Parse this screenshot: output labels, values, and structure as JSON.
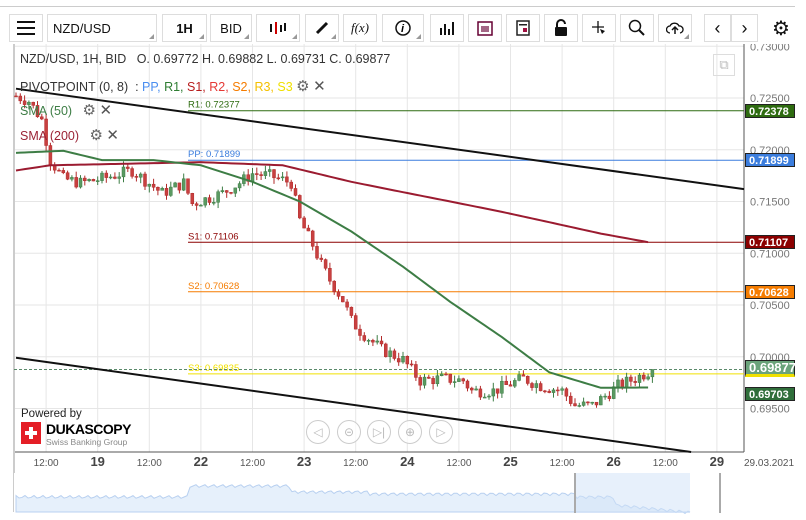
{
  "toolbar": {
    "instrument": "NZD/USD",
    "period": "1H",
    "side": "BID",
    "icons": [
      "menu-icon",
      "candlestick-icon",
      "pencil-icon",
      "function-icon",
      "info-icon",
      "volume-bars-icon",
      "calendar-icon",
      "news-icon",
      "lock-icon",
      "crosshair-icon",
      "zoom-search-icon",
      "cloud-upload-icon",
      "chevron-left-icon",
      "chevron-right-icon",
      "gear-icon"
    ],
    "fx_label": "f(x)"
  },
  "legend": {
    "title": "NZD/USD, 1H, BID",
    "ohlc": "O. 0.69772 H. 0.69882 L. 0.69731 C. 0.69877",
    "pivot": "PIVOTPOINT (0, 8)",
    "pivot_sep": ":",
    "pivot_items": [
      {
        "label": "PP",
        "color": "#4a8ef0"
      },
      {
        "label": "R1",
        "color": "#2e7d32"
      },
      {
        "label": "S1",
        "color": "#b71c1c"
      },
      {
        "label": "R2",
        "color": "#e53935"
      },
      {
        "label": "S2",
        "color": "#f57c00"
      },
      {
        "label": "R3",
        "color": "#f4c000"
      },
      {
        "label": "S3",
        "color": "#f0e000"
      }
    ],
    "sma50": "SMA (50)",
    "sma200": "SMA (200)"
  },
  "pivot_lines": [
    {
      "label": "R1: 0.72377",
      "value": 0.72377,
      "tag": "0.72378",
      "color": "#2e6b10"
    },
    {
      "label": "PP: 0.71899",
      "value": 0.71899,
      "tag": "0.71899",
      "color": "#3b7ddd"
    },
    {
      "label": "S1: 0.71106",
      "value": 0.71106,
      "tag": "0.71107",
      "color": "#8b0000"
    },
    {
      "label": "S2: 0.70628",
      "value": 0.70628,
      "tag": "0.70628",
      "color": "#f57c00"
    },
    {
      "label": "S3: 0.69835",
      "value": 0.69835,
      "tag": "",
      "color": "#f0e000"
    }
  ],
  "current_price": {
    "value": 0.69877,
    "tag": "0.69877",
    "color": "#6aa37a"
  },
  "sma50_value": {
    "value": 0.69703,
    "tag": "0.69703",
    "color": "#2f6e3a"
  },
  "sma200_value": {
    "value": 0.71107,
    "color": "#9b1b30"
  },
  "y_axis": {
    "ticks": [
      "0.73000",
      "0.72500",
      "0.72000",
      "0.71500",
      "0.71000",
      "0.70500",
      "0.70000",
      "0.69500"
    ],
    "values": [
      0.73,
      0.725,
      0.72,
      0.715,
      0.71,
      0.705,
      0.7,
      0.695
    ]
  },
  "x_axis": {
    "labels": [
      {
        "t": 7,
        "text": "12:00",
        "major": false
      },
      {
        "t": 19,
        "text": "19",
        "major": true
      },
      {
        "t": 31,
        "text": "12:00",
        "major": false
      },
      {
        "t": 43,
        "text": "22",
        "major": true
      },
      {
        "t": 55,
        "text": "12:00",
        "major": false
      },
      {
        "t": 67,
        "text": "23",
        "major": true
      },
      {
        "t": 79,
        "text": "12:00",
        "major": false
      },
      {
        "t": 91,
        "text": "24",
        "major": true
      },
      {
        "t": 103,
        "text": "12:00",
        "major": false
      },
      {
        "t": 115,
        "text": "25",
        "major": true
      },
      {
        "t": 127,
        "text": "12:00",
        "major": false
      },
      {
        "t": 139,
        "text": "26",
        "major": true
      },
      {
        "t": 151,
        "text": "12:00",
        "major": false
      },
      {
        "t": 163,
        "text": "29",
        "major": true
      }
    ],
    "date": "29.03.2021"
  },
  "chart_data": {
    "type": "candlestick",
    "close_keypoints": [
      [
        0,
        0.7252
      ],
      [
        3,
        0.7247
      ],
      [
        6,
        0.7229
      ],
      [
        8,
        0.719
      ],
      [
        11,
        0.7172
      ],
      [
        15,
        0.7168
      ],
      [
        20,
        0.7172
      ],
      [
        27,
        0.718
      ],
      [
        34,
        0.7158
      ],
      [
        39,
        0.7168
      ],
      [
        41,
        0.7148
      ],
      [
        48,
        0.7158
      ],
      [
        52,
        0.7168
      ],
      [
        55,
        0.7177
      ],
      [
        59,
        0.7175
      ],
      [
        64,
        0.7168
      ],
      [
        66,
        0.7132
      ],
      [
        69,
        0.7108
      ],
      [
        71,
        0.7089
      ],
      [
        73,
        0.7074
      ],
      [
        76,
        0.7055
      ],
      [
        78,
        0.7035
      ],
      [
        80,
        0.7025
      ],
      [
        85,
        0.7007
      ],
      [
        90,
        0.6997
      ],
      [
        94,
        0.6977
      ],
      [
        99,
        0.6979
      ],
      [
        104,
        0.6977
      ],
      [
        106,
        0.6967
      ],
      [
        111,
        0.6967
      ],
      [
        118,
        0.6979
      ],
      [
        122,
        0.6972
      ],
      [
        127,
        0.6967
      ],
      [
        130,
        0.6953
      ],
      [
        134,
        0.6953
      ],
      [
        137,
        0.6962
      ],
      [
        140,
        0.6972
      ],
      [
        144,
        0.6979
      ],
      [
        148,
        0.69877
      ]
    ],
    "sma50": [
      [
        0,
        0.7197
      ],
      [
        11,
        0.7199
      ],
      [
        20,
        0.719
      ],
      [
        32,
        0.719
      ],
      [
        43,
        0.7185
      ],
      [
        55,
        0.7169
      ],
      [
        66,
        0.715
      ],
      [
        78,
        0.7121
      ],
      [
        90,
        0.7087
      ],
      [
        101,
        0.7053
      ],
      [
        113,
        0.7019
      ],
      [
        124,
        0.6985
      ],
      [
        136,
        0.697
      ],
      [
        147,
        0.69703
      ]
    ],
    "sma200": [
      [
        0,
        0.718
      ],
      [
        8,
        0.7185
      ],
      [
        20,
        0.7186
      ],
      [
        43,
        0.7188
      ],
      [
        62,
        0.7185
      ],
      [
        78,
        0.7169
      ],
      [
        90,
        0.7159
      ],
      [
        101,
        0.715
      ],
      [
        113,
        0.714
      ],
      [
        124,
        0.713
      ],
      [
        136,
        0.7119
      ],
      [
        147,
        0.71107
      ]
    ],
    "trendlines": [
      [
        [
          0,
          0.7259
        ],
        [
          170,
          0.7162
        ]
      ],
      [
        [
          0,
          0.6999
        ],
        [
          157,
          0.6908
        ]
      ]
    ]
  },
  "branding": {
    "powered_by": "Powered by",
    "name": "DUKASCOPY",
    "tagline": "Swiss Banking Group"
  },
  "nav_buttons": [
    "scroll-left",
    "zoom-out",
    "reset",
    "zoom-in",
    "scroll-right"
  ]
}
